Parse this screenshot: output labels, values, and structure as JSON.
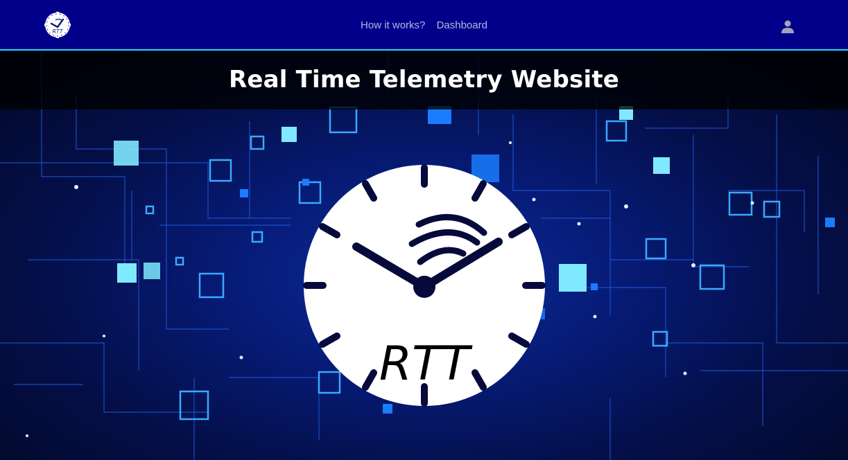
{
  "navbar": {
    "logo_text": "RTT",
    "links": [
      {
        "label": "How it works?"
      },
      {
        "label": "Dashboard"
      }
    ],
    "user_icon": "user-icon"
  },
  "hero": {
    "title": "Real Time Telemetry Website",
    "clock_label": "RTT",
    "clock_icon": "clock-icon",
    "background": "circuit-board-pattern"
  },
  "colors": {
    "navbar_bg": "#00008b",
    "navbar_border": "#2cd6e8",
    "nav_link": "#b4b8e0",
    "accent_cyan": "#2cd6e8",
    "hero_blue": "#0a2d9c"
  }
}
